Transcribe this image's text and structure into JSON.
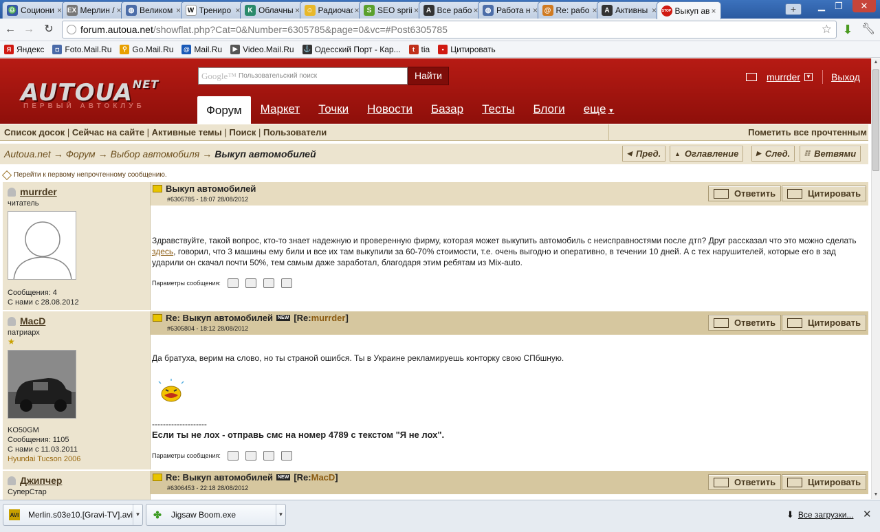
{
  "browser": {
    "tabs": [
      {
        "label": "Социони",
        "icon": "scale-icon",
        "icon_color": "#3a5aa8",
        "glyph": "♎"
      },
      {
        "label": "Мерлин /",
        "icon": "ex-icon",
        "icon_color": "#777",
        "glyph": "EX"
      },
      {
        "label": "Великом",
        "icon": "globe-icon",
        "icon_color": "#4c6da8",
        "glyph": "◍"
      },
      {
        "label": "Трениро",
        "icon": "wikipedia-icon",
        "icon_color": "#fff",
        "glyph": "W"
      },
      {
        "label": "Облачны",
        "icon": "k-logo-icon",
        "icon_color": "#2a8a6a",
        "glyph": "K"
      },
      {
        "label": "Радиочас",
        "icon": "smiley-icon",
        "icon_color": "#e8b82a",
        "glyph": "☺"
      },
      {
        "label": "SEO sprii",
        "icon": "s-logo-icon",
        "icon_color": "#5aa02c",
        "glyph": "S"
      },
      {
        "label": "Все рабо",
        "icon": "a-logo-icon",
        "icon_color": "#333",
        "glyph": "A"
      },
      {
        "label": "Работа н",
        "icon": "globe-icon",
        "icon_color": "#4c6da8",
        "glyph": "◍"
      },
      {
        "label": "Re: рабо",
        "icon": "at-icon",
        "icon_color": "#d07a20",
        "glyph": "@"
      },
      {
        "label": "Активны",
        "icon": "a-logo-icon",
        "icon_color": "#333",
        "glyph": "A"
      },
      {
        "label": "Выкуп ав",
        "icon": "stop-icon",
        "icon_color": "#d01a12",
        "glyph": "STOP",
        "active": true
      }
    ],
    "url_host": "forum.autoua.net",
    "url_rest": "/showflat.php?Cat=0&Number=6305785&page=0&vc=#Post6305785",
    "bookmarks": [
      {
        "label": "Яндекс",
        "icon": "yandex-icon",
        "color": "#d01a12",
        "glyph": "Я"
      },
      {
        "label": "Foto.Mail.Ru",
        "icon": "camera-icon",
        "color": "#4a6aa8",
        "glyph": "◘"
      },
      {
        "label": "Go.Mail.Ru",
        "icon": "search-icon",
        "color": "#e8a000",
        "glyph": "⚲"
      },
      {
        "label": "Mail.Ru",
        "icon": "at-icon",
        "color": "#1a5ab8",
        "glyph": "@"
      },
      {
        "label": "Video.Mail.Ru",
        "icon": "video-icon",
        "color": "#555",
        "glyph": "▶"
      },
      {
        "label": "Одесский Порт - Кар...",
        "icon": "ship-icon",
        "color": "#333",
        "glyph": "⚓"
      },
      {
        "label": "tia",
        "icon": "tia-icon",
        "color": "#c0301a",
        "glyph": "t"
      },
      {
        "label": "Цитировать",
        "icon": "stop-icon",
        "color": "#d01a12",
        "glyph": "•"
      }
    ]
  },
  "site": {
    "logo": "AUTOUA",
    "logo_sup": "NET",
    "logo_sub": "ПЕРВЫЙ АВТОКЛУБ",
    "search_brand": "Google™",
    "search_placeholder": "Пользовательский поиск",
    "search_button": "Найти",
    "username": "murrder",
    "logout": "Выход",
    "nav": [
      {
        "label": "Форум",
        "active": true
      },
      {
        "label": "Маркет"
      },
      {
        "label": "Точки"
      },
      {
        "label": "Новости"
      },
      {
        "label": "Базар"
      },
      {
        "label": "Тесты"
      },
      {
        "label": "Блоги"
      },
      {
        "label": "еще",
        "caret": true
      }
    ]
  },
  "forum": {
    "menu": [
      "Список досок",
      "Сейчас на сайте",
      "Активные темы",
      "Поиск",
      "Пользователи"
    ],
    "mark_all_read": "Пометить все прочтенным",
    "breadcrumb": [
      "Autoua.net",
      "Форум",
      "Выбор автомобиля"
    ],
    "breadcrumb_current": "Выкуп автомобилей",
    "arrow": "→",
    "nav_buttons": {
      "prev": "Пред.",
      "index": "Оглавление",
      "next": "След.",
      "threads": "Ветвями"
    },
    "first_unread": "Перейти к первому непрочтенному сообщению.",
    "reply_label": "Ответить",
    "quote_label": "Цитировать",
    "params_label": "Параметры сообщения:",
    "new_badge": "NEW",
    "posts": [
      {
        "author": "murrder",
        "rank": "читатель",
        "messages": "Сообщения: 4",
        "since": "С нами с 28.08.2012",
        "title": "Выкуп автомобилей",
        "meta": "#6305785 - 18:07 28/08/2012",
        "body_1": "Здравствуйте, такой вопрос, кто-то знает надежную и проверенную фирму, которая может выкупить автомобиль с неисправностями после дтп? Друг рассказал что это можно сделать ",
        "link": "здесь",
        "body_2": ", говорил, что 3 машины ему били и все их там выкупили за 60-70% стоимости, т.е. очень выгодно и оперативно, в течении 10 дней. А с тех нарушителей, которые его в зад ударили он скачал почти 50%, тем самым даже заработал, благодаря этим ребятам из Mix-auto."
      },
      {
        "author": "MacD",
        "rank": "патриарх",
        "star": "★",
        "callsign": "KO50GM",
        "messages": "Сообщения: 1105",
        "since": "С нами с 11.03.2011",
        "car": "Hyundai Tucson 2006",
        "title": "Re: Выкуп автомобилей",
        "re_prefix": "[Re: ",
        "re_user": "murrder",
        "re_suffix": "]",
        "meta": "#6305804 - 18:12 28/08/2012",
        "body": "Да братуха, верим на слово, но ты страной ошибся. Ты в Украине рекламируешь конторку свою СПбшную.",
        "sig_line": "--------------------",
        "signature": "Если ты не лох - отправь смс на номер 4789 с текстом \"Я не лох\"."
      },
      {
        "author": "Джипчер",
        "rank": "СуперСтар",
        "title": "Re: Выкуп автомобилей",
        "re_prefix": "[Re: ",
        "re_user": "MacD",
        "re_suffix": "]",
        "meta": "#6306453 - 22:18 28/08/2012"
      }
    ]
  },
  "downloads": {
    "items": [
      {
        "label": "Merlin.s03e10.[Gravi-TV].avi",
        "icon": "avi-file-icon"
      },
      {
        "label": "Jigsaw Boom.exe",
        "icon": "puzzle-icon"
      }
    ],
    "all": "Все загрузки..."
  }
}
